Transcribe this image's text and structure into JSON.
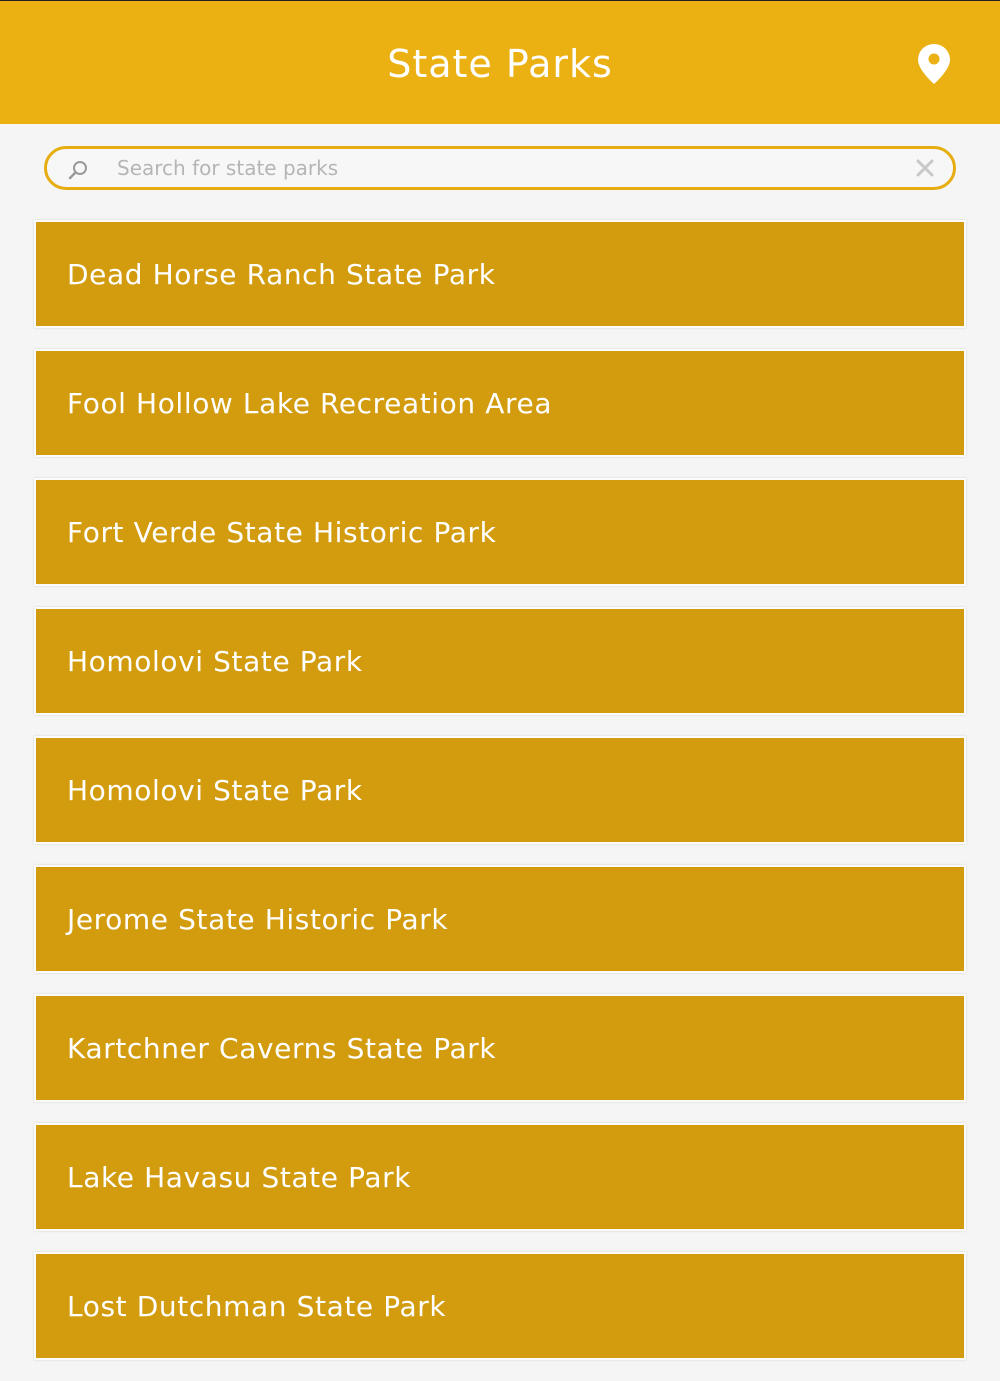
{
  "header": {
    "title": "State Parks",
    "location_icon": "map-pin-icon"
  },
  "search": {
    "placeholder": "Search for state parks",
    "value": "",
    "search_icon": "magnifier-icon",
    "clear_icon": "close-icon"
  },
  "parks": [
    {
      "label": "Dead Horse Ranch State Park"
    },
    {
      "label": "Fool Hollow Lake Recreation Area"
    },
    {
      "label": "Fort Verde State Historic Park"
    },
    {
      "label": "Homolovi State Park"
    },
    {
      "label": "Homolovi State Park"
    },
    {
      "label": "Jerome State Historic Park"
    },
    {
      "label": "Kartchner Caverns State Park"
    },
    {
      "label": "Lake Havasu State Park"
    },
    {
      "label": "Lost Dutchman State Park"
    }
  ],
  "colors": {
    "header_bg": "#ebb011",
    "item_bg": "#d39c0f",
    "page_bg": "#f5f5f5",
    "search_border": "#e6ad10"
  }
}
